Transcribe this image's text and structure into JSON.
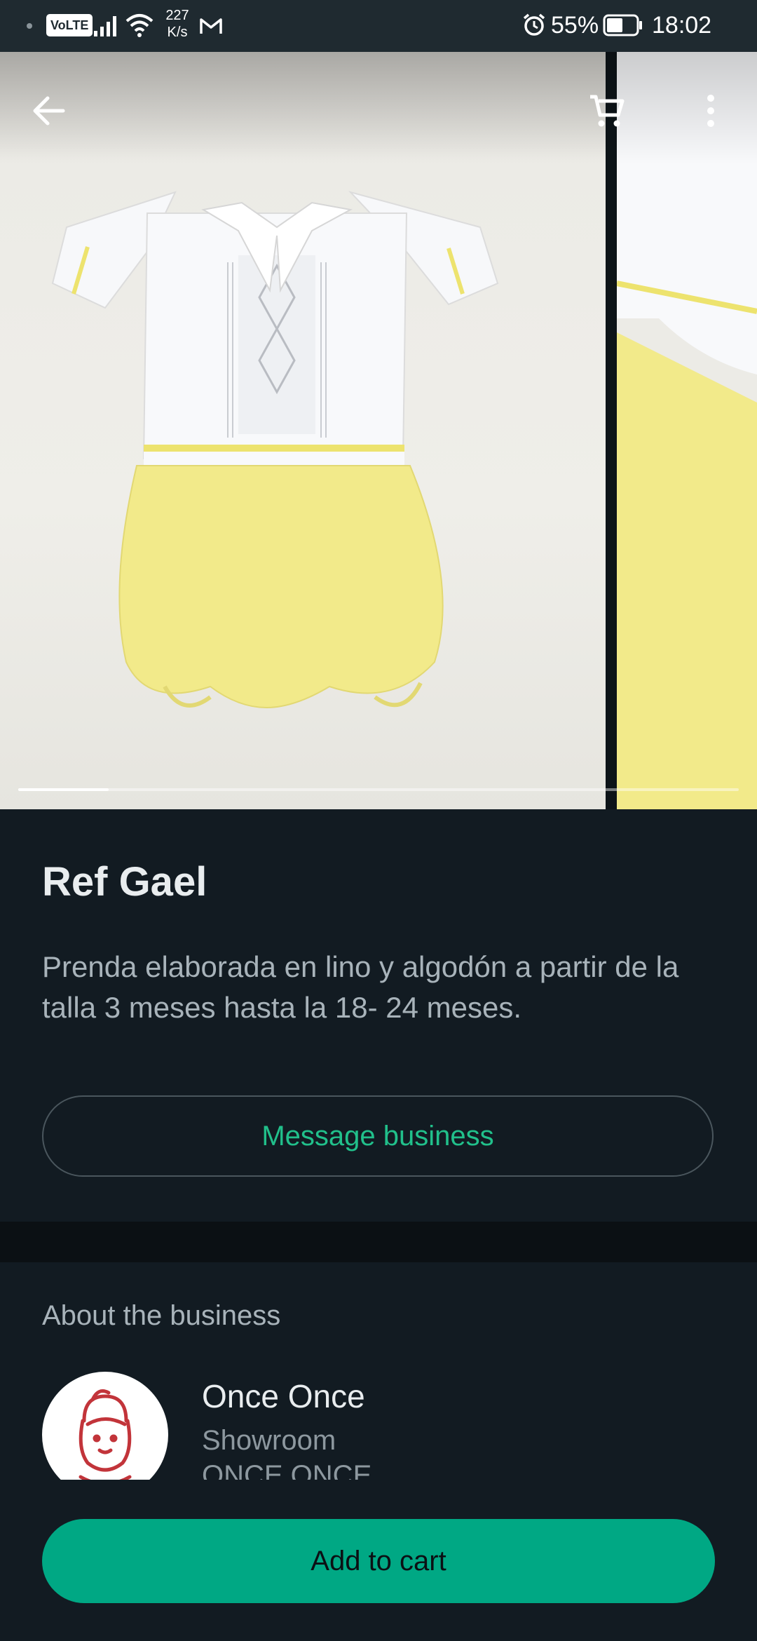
{
  "status_bar": {
    "volte_label": "VoLTE",
    "net_speed_value": "227",
    "net_speed_unit": "K/s",
    "battery_percent": "55%",
    "time": "18:02",
    "icons": [
      "signal-icon",
      "wifi-icon",
      "gmail-icon",
      "alarm-icon",
      "battery-icon"
    ]
  },
  "gallery": {
    "image_description_names": [
      "product-photo-romper",
      "product-photo-next"
    ],
    "progress_fraction": 0.125
  },
  "toolbar": {
    "back_icon": "arrow-left-icon",
    "cart_icon": "cart-icon",
    "more_icon": "more-vertical-icon"
  },
  "product": {
    "title": "Ref Gael",
    "description": "Prenda elaborada en lino y algodón a partir de la talla 3 meses hasta la 18- 24 meses.",
    "message_button_label": "Message business"
  },
  "about": {
    "heading": "About the business",
    "business_name": "Once Once",
    "business_category": "Showroom",
    "business_description": "ONCE ONCE"
  },
  "actions": {
    "add_to_cart_label": "Add to cart"
  },
  "colors": {
    "accent": "#00a884",
    "accent_text": "#21c08b",
    "background": "#121b22",
    "status_bar": "#1f2a30"
  }
}
